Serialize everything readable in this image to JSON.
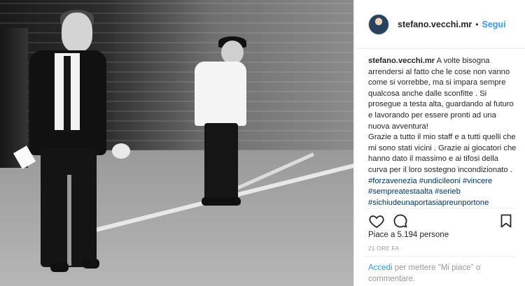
{
  "post": {
    "username": "stefano.vecchi.mr",
    "separator": "•",
    "follow_label": "Segui",
    "caption_author": "stefano.vecchi.mr",
    "caption_text": "A volte bisogna arrendersi al fatto che le cose non vanno come si vorrebbe, ma si impara sempre qualcosa anche dalle sconfitte . Si prosegue a testa alta, guardando al futuro e lavorando per essere pronti ad una nuova avventura!",
    "caption_thanks": "Grazie a tutto il mio staff e a tutti quelli che mi sono stati vicini . Grazie ai giocatori che hanno dato il massimo e ai tifosi della curva per il loro sostegno incondizionato .",
    "hashtags": [
      "#forzavenezia",
      "#undicileoni",
      "#vincere",
      "#sempreatestaalta",
      "#serieb",
      "#sichiudeunaportasiapreunportone"
    ],
    "likes_label": "Piace a 5.194 persone",
    "time_ago": "21 ORE FA",
    "login_link": "Accedi",
    "login_text": "per mettere \"Mi piace\" o commentare."
  },
  "icons": {
    "like": "heart-icon",
    "comment": "comment-icon",
    "save": "bookmark-icon"
  },
  "colors": {
    "accent": "#3897f0",
    "hashtag": "#003569",
    "muted": "#999999"
  }
}
